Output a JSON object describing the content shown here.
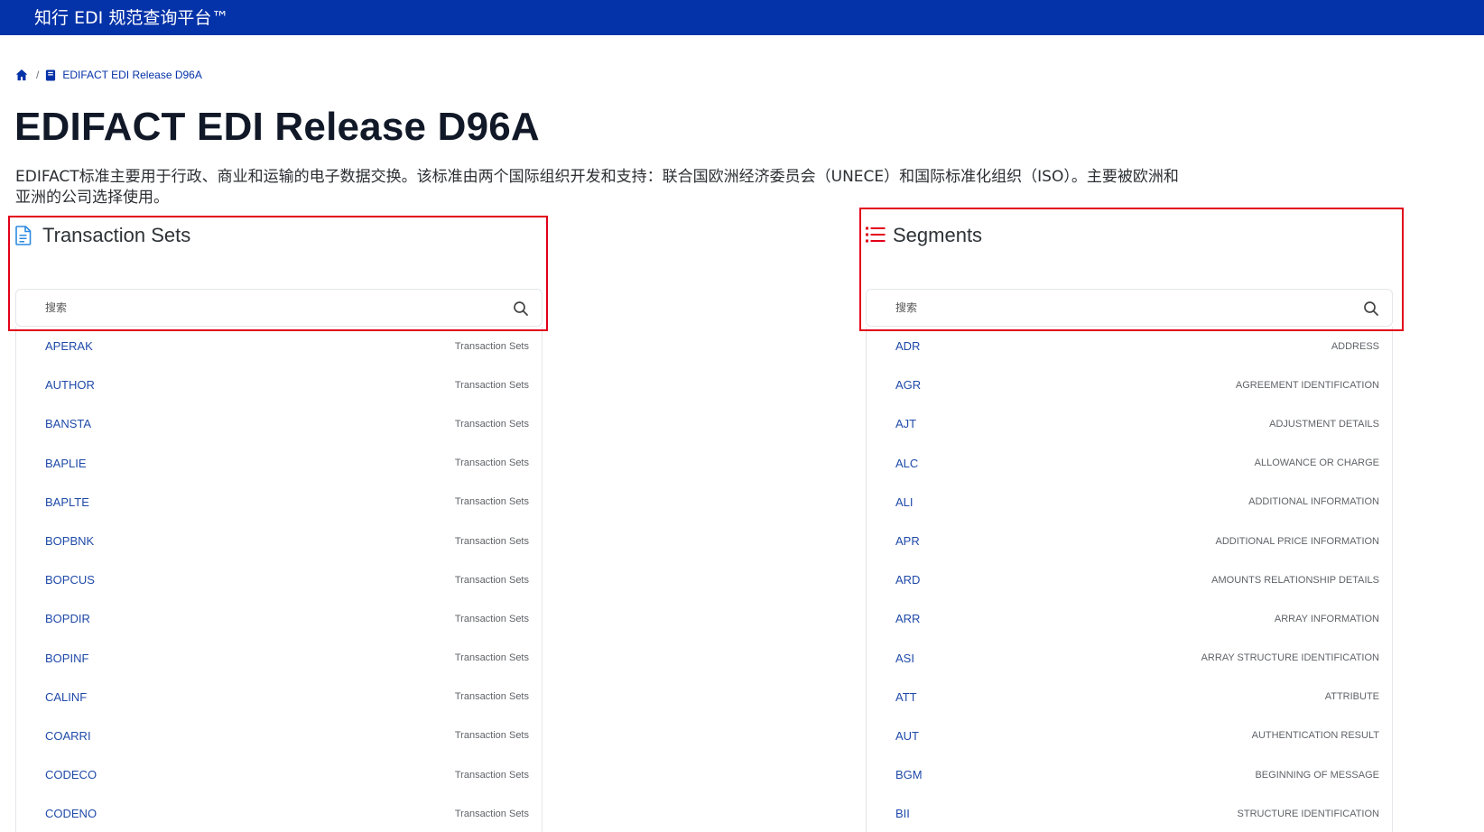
{
  "topbar": {
    "brand": "知行 EDI 规范查询平台™"
  },
  "breadcrumb": {
    "current": "EDIFACT EDI Release D96A"
  },
  "page": {
    "title": "EDIFACT EDI Release D96A",
    "description": "EDIFACT标准主要用于行政、商业和运输的电子数据交换。该标准由两个国际组织开发和支持：联合国欧洲经济委员会（UNECE）和国际标准化组织（ISO）。主要被欧洲和亚洲的公司选择使用。"
  },
  "transaction_sets": {
    "title": "Transaction Sets",
    "search_placeholder": "搜索",
    "items": [
      {
        "code": "APERAK",
        "desc": "Transaction Sets"
      },
      {
        "code": "AUTHOR",
        "desc": "Transaction Sets"
      },
      {
        "code": "BANSTA",
        "desc": "Transaction Sets"
      },
      {
        "code": "BAPLIE",
        "desc": "Transaction Sets"
      },
      {
        "code": "BAPLTE",
        "desc": "Transaction Sets"
      },
      {
        "code": "BOPBNK",
        "desc": "Transaction Sets"
      },
      {
        "code": "BOPCUS",
        "desc": "Transaction Sets"
      },
      {
        "code": "BOPDIR",
        "desc": "Transaction Sets"
      },
      {
        "code": "BOPINF",
        "desc": "Transaction Sets"
      },
      {
        "code": "CALINF",
        "desc": "Transaction Sets"
      },
      {
        "code": "COARRI",
        "desc": "Transaction Sets"
      },
      {
        "code": "CODECO",
        "desc": "Transaction Sets"
      },
      {
        "code": "CODENO",
        "desc": "Transaction Sets"
      }
    ]
  },
  "segments": {
    "title": "Segments",
    "search_placeholder": "搜索",
    "items": [
      {
        "code": "ADR",
        "desc": "ADDRESS"
      },
      {
        "code": "AGR",
        "desc": "AGREEMENT IDENTIFICATION"
      },
      {
        "code": "AJT",
        "desc": "ADJUSTMENT DETAILS"
      },
      {
        "code": "ALC",
        "desc": "ALLOWANCE OR CHARGE"
      },
      {
        "code": "ALI",
        "desc": "ADDITIONAL INFORMATION"
      },
      {
        "code": "APR",
        "desc": "ADDITIONAL PRICE INFORMATION"
      },
      {
        "code": "ARD",
        "desc": "AMOUNTS RELATIONSHIP DETAILS"
      },
      {
        "code": "ARR",
        "desc": "ARRAY INFORMATION"
      },
      {
        "code": "ASI",
        "desc": "ARRAY STRUCTURE IDENTIFICATION"
      },
      {
        "code": "ATT",
        "desc": "ATTRIBUTE"
      },
      {
        "code": "AUT",
        "desc": "AUTHENTICATION RESULT"
      },
      {
        "code": "BGM",
        "desc": "BEGINNING OF MESSAGE"
      },
      {
        "code": "BII",
        "desc": "STRUCTURE IDENTIFICATION"
      }
    ]
  },
  "colors": {
    "topbar": "#0432a8",
    "link": "#1f4aa8",
    "transaction_icon": "#2b8be0",
    "segments_icon": "#e2001a",
    "highlight": "#e2001a"
  },
  "icons": {
    "breadcrumb_home": "home-icon",
    "breadcrumb_book": "book-icon",
    "transaction_sets": "document-icon",
    "segments": "list-icon",
    "search": "search-icon"
  }
}
